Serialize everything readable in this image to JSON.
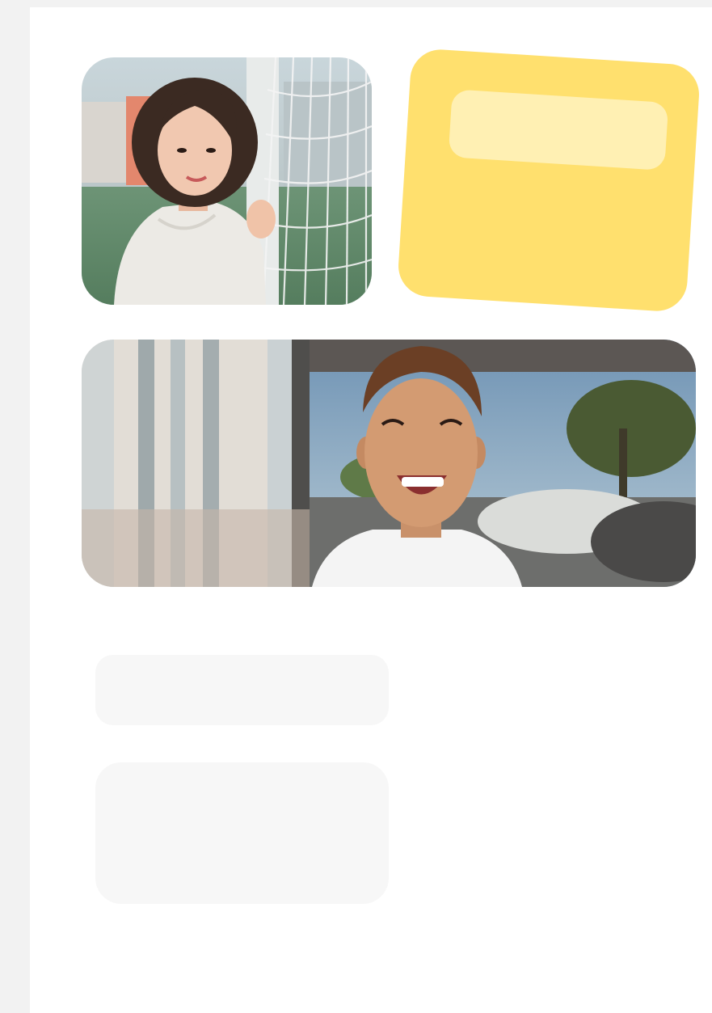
{
  "colors": {
    "outer_background": "#f2f2f2",
    "page_background": "#ffffff",
    "card_yellow": "#ffe06e",
    "card_field": "#fff0b3",
    "placeholder": "#f7f7f7"
  },
  "photos": [
    {
      "subject": "woman-by-goal-net",
      "icon": "photo-icon"
    },
    {
      "subject": "laughing-boy",
      "icon": "photo-icon"
    }
  ],
  "sticky_card": {
    "field_value": ""
  },
  "placeholders": [
    {
      "text": ""
    },
    {
      "text": ""
    }
  ]
}
